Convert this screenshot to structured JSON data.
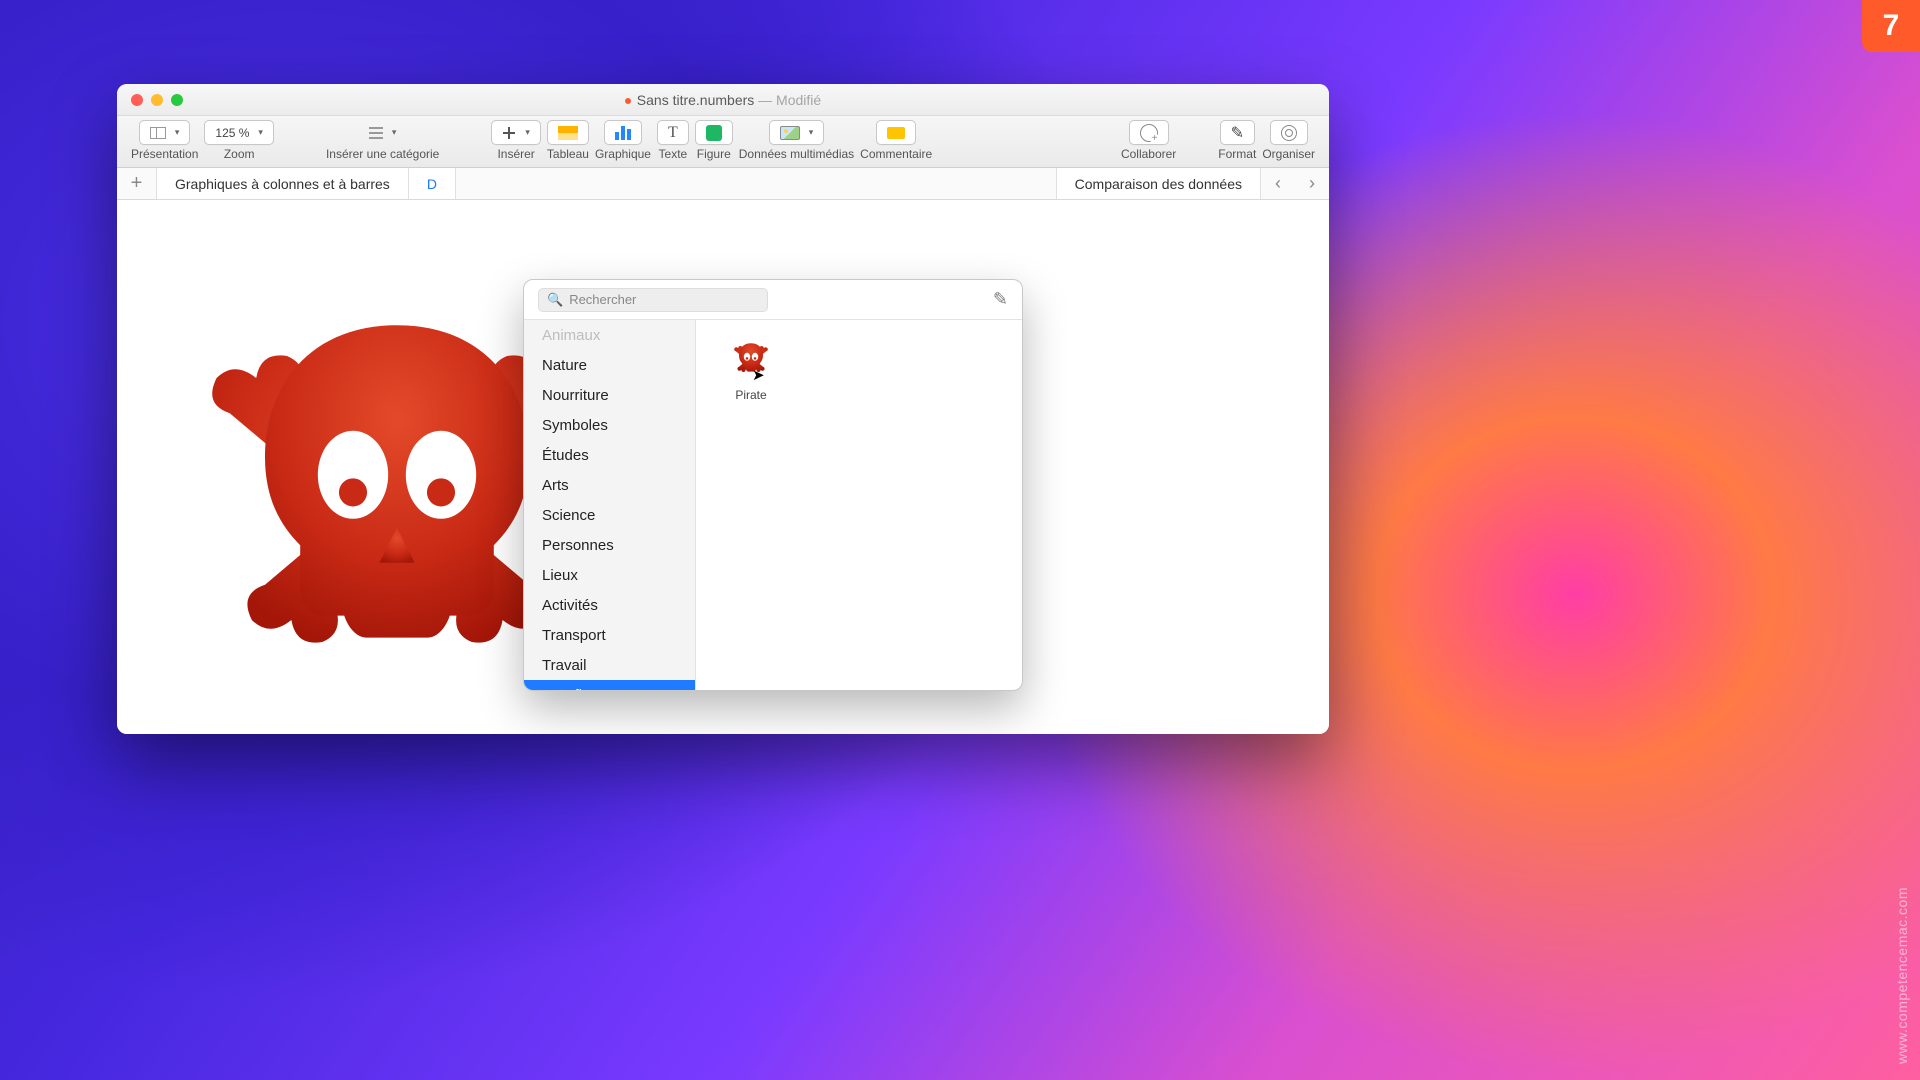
{
  "badge": "7",
  "watermark": "www.competencemac.com",
  "window": {
    "title_main": "Sans titre.numbers",
    "title_suffix": " — Modifié"
  },
  "toolbar": {
    "presentation": "Présentation",
    "zoom_label": "Zoom",
    "zoom_value": "125 %",
    "insert_category": "Insérer une catégorie",
    "insert": "Insérer",
    "table": "Tableau",
    "chart": "Graphique",
    "text": "Texte",
    "shape": "Figure",
    "media": "Données multimédias",
    "comment": "Commentaire",
    "collaborate": "Collaborer",
    "format": "Format",
    "organize": "Organiser"
  },
  "sheets": {
    "tab1": "Graphiques à colonnes et à barres",
    "tab2_partial": "D",
    "reference": "Comparaison des données"
  },
  "popover": {
    "search_placeholder": "Rechercher",
    "categories": [
      "Animaux",
      "Nature",
      "Nourriture",
      "Symboles",
      "Études",
      "Arts",
      "Science",
      "Personnes",
      "Lieux",
      "Activités",
      "Transport",
      "Travail",
      "Mes figures"
    ],
    "selected_category": "Mes figures",
    "shapes": [
      {
        "name": "Pirate"
      }
    ]
  }
}
